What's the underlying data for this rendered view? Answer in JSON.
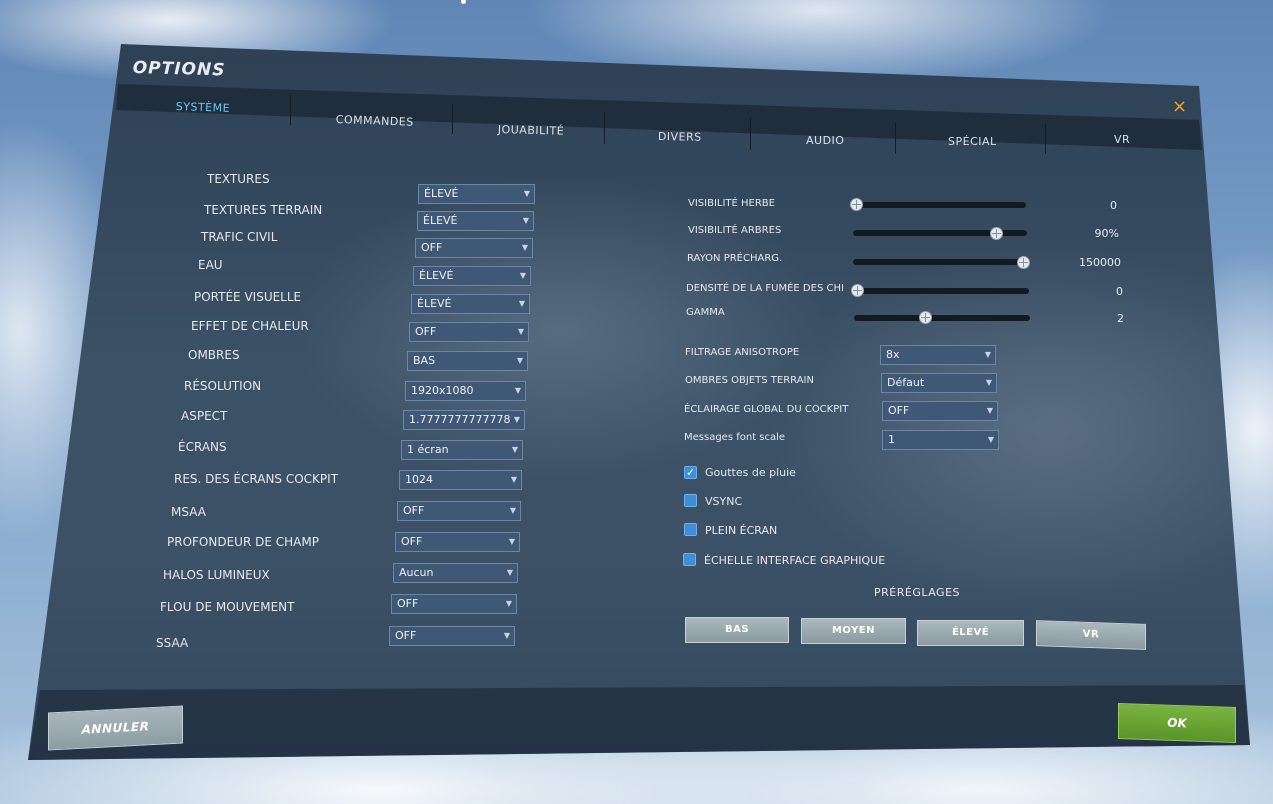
{
  "window": {
    "title": "OPTIONS",
    "close_label": "×"
  },
  "tabs": [
    {
      "label": "SYSTÈME",
      "active": true
    },
    {
      "label": "COMMANDES",
      "active": false
    },
    {
      "label": "JOUABILITÉ",
      "active": false
    },
    {
      "label": "DIVERS",
      "active": false
    },
    {
      "label": "AUDIO",
      "active": false
    },
    {
      "label": "SPÉCIAL",
      "active": false
    },
    {
      "label": "VR",
      "active": false
    }
  ],
  "left_settings": [
    {
      "label": "TEXTURES",
      "value": "ÉLEVÉ"
    },
    {
      "label": "TEXTURES TERRAIN",
      "value": "ÉLEVÉ"
    },
    {
      "label": "TRAFIC CIVIL",
      "value": "OFF"
    },
    {
      "label": "EAU",
      "value": "ÉLEVÉ"
    },
    {
      "label": "PORTÉE VISUELLE",
      "value": "ÉLEVÉ"
    },
    {
      "label": "EFFET DE CHALEUR",
      "value": "OFF"
    },
    {
      "label": "OMBRES",
      "value": "BAS"
    },
    {
      "label": "RÉSOLUTION",
      "value": "1920x1080"
    },
    {
      "label": "ASPECT",
      "value": "1.7777777777778"
    },
    {
      "label": "ÉCRANS",
      "value": "1 écran"
    },
    {
      "label": "RES. DES ÉCRANS COCKPIT",
      "value": "1024"
    },
    {
      "label": "MSAA",
      "value": "OFF"
    },
    {
      "label": "PROFONDEUR DE CHAMP",
      "value": "OFF"
    },
    {
      "label": "HALOS LUMINEUX",
      "value": "Aucun"
    },
    {
      "label": "FLOU DE MOUVEMENT",
      "value": "OFF"
    },
    {
      "label": "SSAA",
      "value": "OFF"
    }
  ],
  "sliders": [
    {
      "label": "VISIBILITÉ HERBE",
      "value": "0",
      "fraction": 0.0
    },
    {
      "label": "VISIBILITÉ ARBRES",
      "value": "90%",
      "fraction": 0.84
    },
    {
      "label": "RAYON PRÉCHARG.",
      "value": "150000",
      "fraction": 1.0
    },
    {
      "label": "DENSITÉ DE LA FUMÉE DES CHI",
      "value": "0",
      "fraction": 0.0
    },
    {
      "label": "GAMMA",
      "value": "2",
      "fraction": 0.4
    }
  ],
  "right_settings": [
    {
      "label": "FILTRAGE ANISOTROPE",
      "value": "8x"
    },
    {
      "label": "OMBRES OBJETS TERRAIN",
      "value": "Défaut"
    },
    {
      "label": "ÉCLAIRAGE GLOBAL DU COCKPIT",
      "value": "OFF"
    },
    {
      "label": "Messages font scale",
      "value": "1"
    }
  ],
  "checkboxes": [
    {
      "label": "Gouttes de pluie",
      "checked": true,
      "mark": "✓"
    },
    {
      "label": "VSYNC",
      "checked": false,
      "mark": ""
    },
    {
      "label": "PLEIN ÉCRAN",
      "checked": false,
      "mark": ""
    },
    {
      "label": "ÉCHELLE INTERFACE GRAPHIQUE",
      "checked": false,
      "mark": ""
    }
  ],
  "presets": {
    "title": "PRÉRÉGLAGES",
    "buttons": [
      "BAS",
      "MOYEN",
      "ÉLEVÉ",
      "VR"
    ]
  },
  "footer": {
    "cancel_label": "ANNULER",
    "ok_label": "OK"
  },
  "colors": {
    "accent_tab": "#6fc6ea",
    "ok_green": "#6aa534",
    "close_orange": "#f0a030",
    "checkbox_blue": "#3f8fd8"
  },
  "icons": {
    "close": "close-icon",
    "dropdown": "chevron-down-icon",
    "check": "checkmark-icon"
  }
}
